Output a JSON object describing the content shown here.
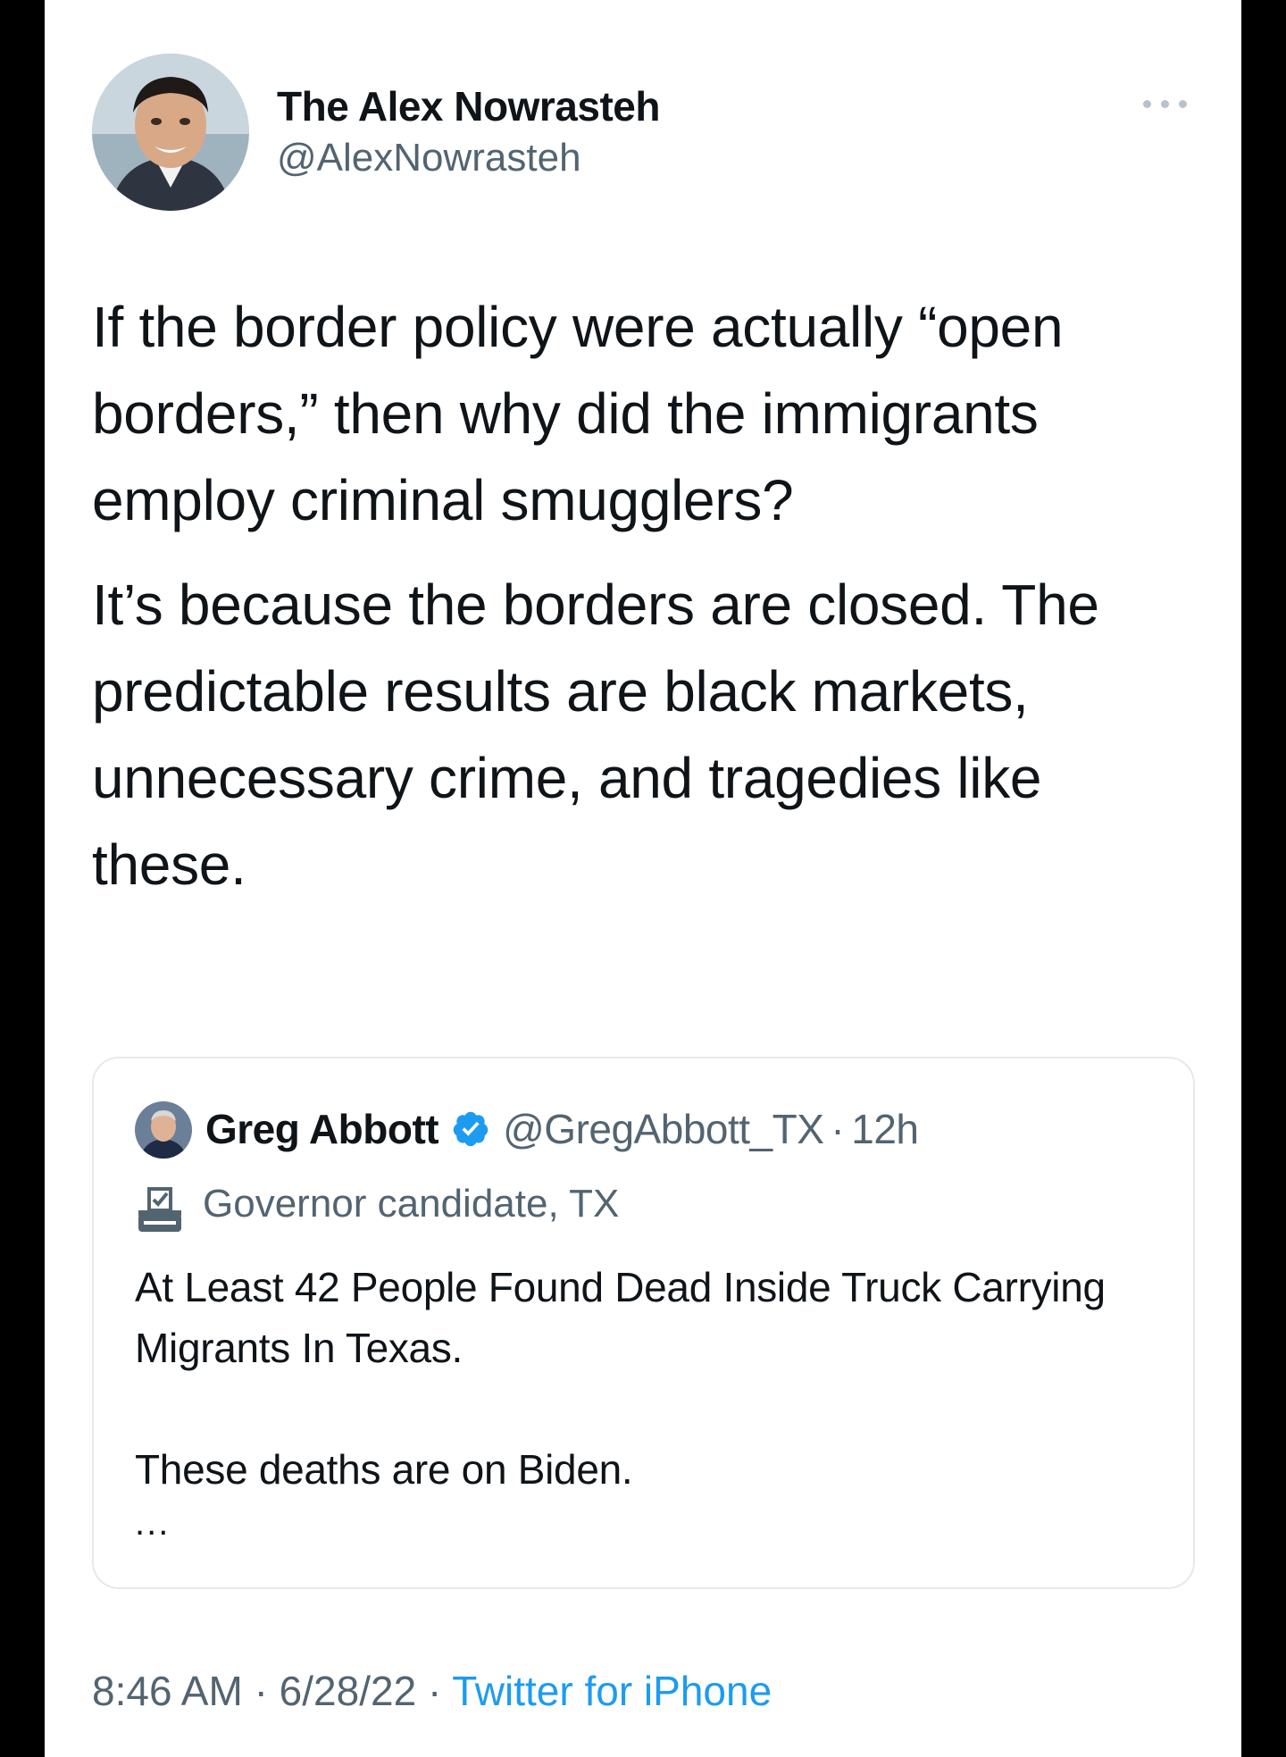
{
  "tweet": {
    "author": {
      "display_name": "The Alex Nowrasteh",
      "handle": "@AlexNowrasteh"
    },
    "paragraphs": [
      "If the border policy were actually “open borders,” then why did the immigrants employ criminal smugglers?",
      "It’s because the borders are closed. The predictable results are black markets, unnecessary crime, and tragedies like these."
    ],
    "time": "8:46 AM",
    "date": "6/28/22",
    "source": "Twitter for iPhone",
    "separator": "·"
  },
  "quoted_tweet": {
    "author": {
      "display_name": "Greg Abbott",
      "handle": "@GregAbbott_TX",
      "age": "12h",
      "verified_icon": "verified-badge-icon"
    },
    "label": "Governor candidate, TX",
    "label_icon": "ballot-box-icon",
    "lines": [
      "At Least 42 People Found Dead Inside Truck Carrying Migrants In Texas.",
      "These deaths are on Biden."
    ],
    "ellipsis": "..."
  },
  "colors": {
    "text": "#0f1419",
    "secondary": "#536471",
    "link": "#1d9bf0",
    "verified": "#1d9bf0",
    "border": "#e4e9ed"
  }
}
